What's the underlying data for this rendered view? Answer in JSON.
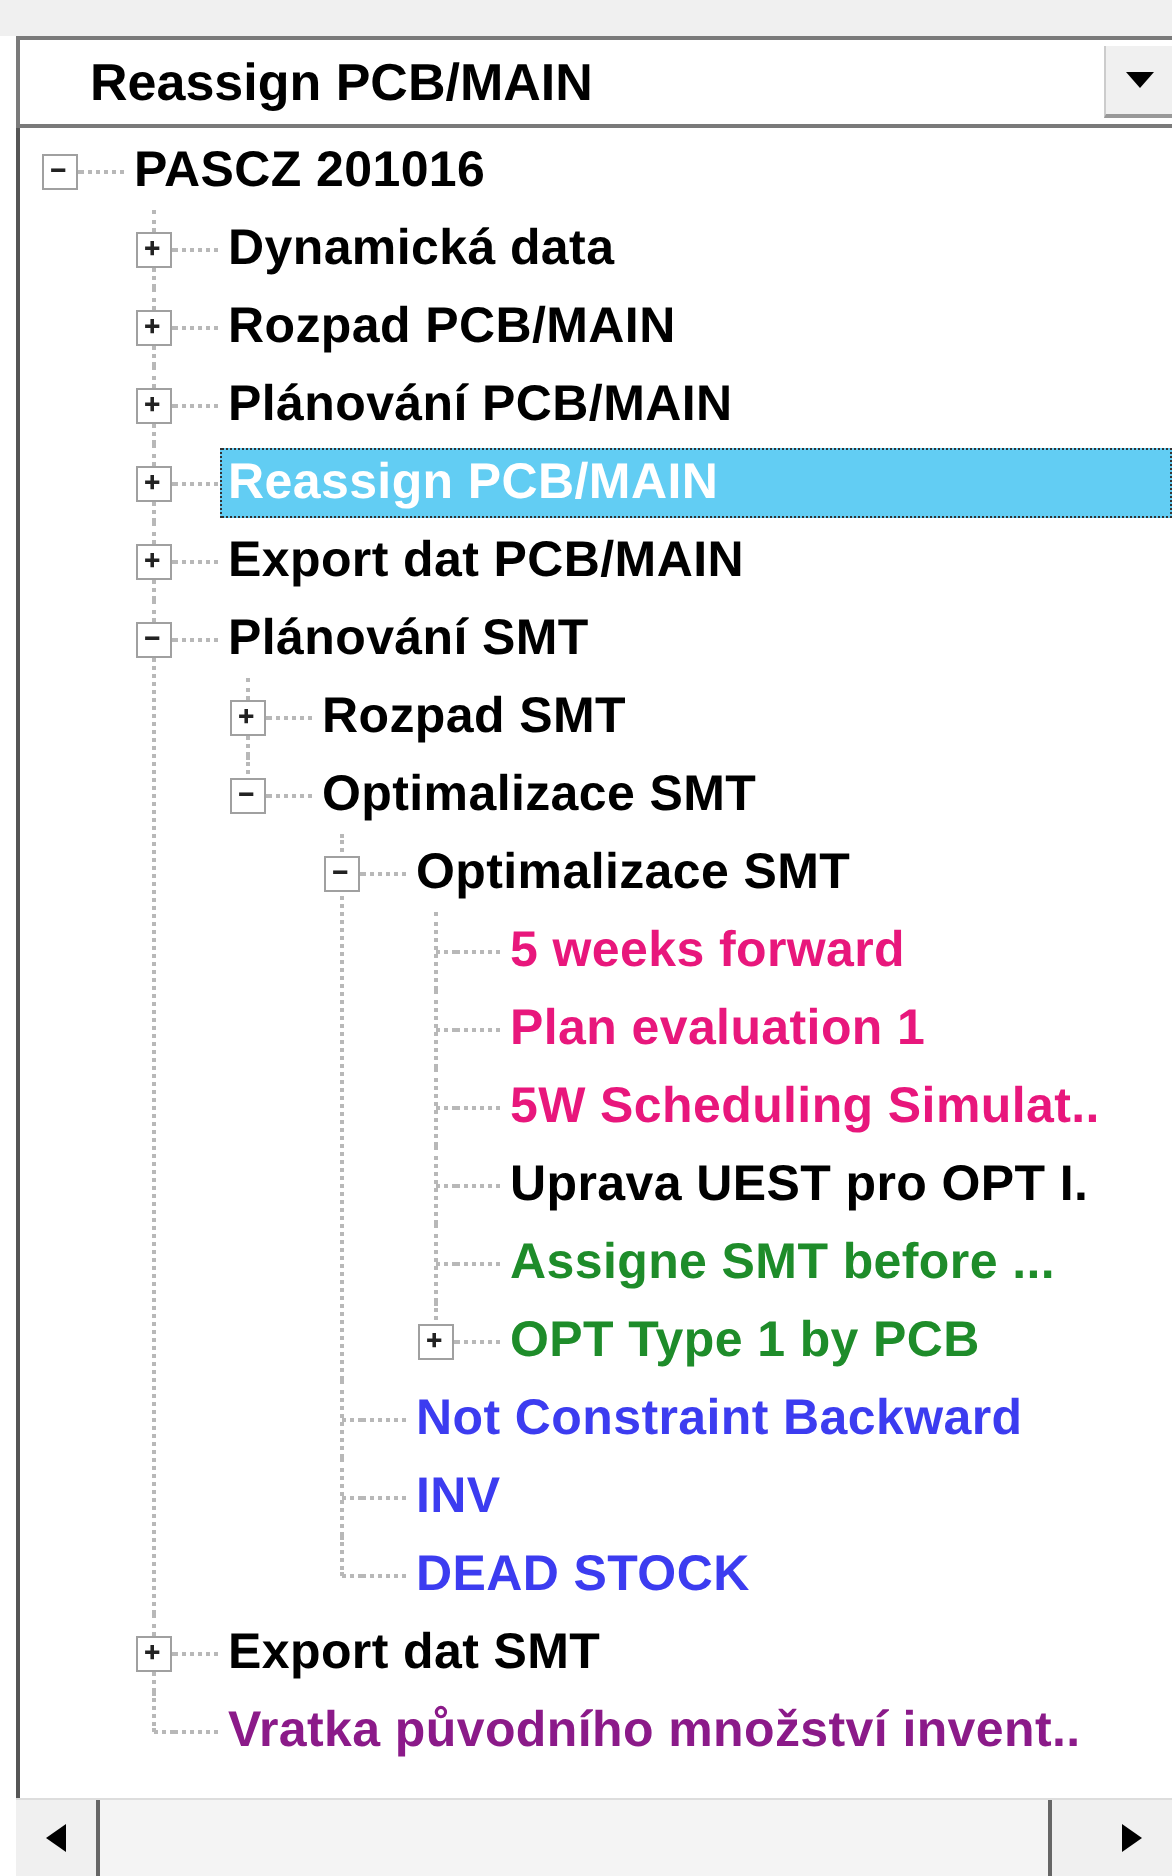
{
  "combo": {
    "value": "Reassign PCB/MAIN"
  },
  "tree": [
    {
      "label": "PASCZ 201016",
      "expanded": true,
      "selected": false,
      "color": "#000000",
      "children": [
        {
          "label": "Dynamická data",
          "expanded": false,
          "selected": false,
          "color": "#000000"
        },
        {
          "label": "Rozpad PCB/MAIN",
          "expanded": false,
          "selected": false,
          "color": "#000000"
        },
        {
          "label": "Plánování PCB/MAIN",
          "expanded": false,
          "selected": false,
          "color": "#000000"
        },
        {
          "label": "Reassign PCB/MAIN",
          "expanded": false,
          "selected": true
        },
        {
          "label": "Export dat PCB/MAIN",
          "expanded": false,
          "selected": false,
          "color": "#000000"
        },
        {
          "label": "Plánování SMT",
          "expanded": true,
          "selected": false,
          "color": "#000000",
          "children": [
            {
              "label": "Rozpad SMT",
              "expanded": false,
              "selected": false,
              "color": "#000000"
            },
            {
              "label": "Optimalizace SMT",
              "expanded": true,
              "selected": false,
              "color": "#000000",
              "children": [
                {
                  "label": "Optimalizace SMT",
                  "expanded": true,
                  "selected": false,
                  "color": "#000000",
                  "children": [
                    {
                      "label": "5 weeks forward",
                      "selected": false,
                      "color": "#e8177c"
                    },
                    {
                      "label": "Plan evaluation 1",
                      "selected": false,
                      "color": "#e8177c"
                    },
                    {
                      "label": "5W Scheduling Simulat..",
                      "selected": false,
                      "color": "#e8177c"
                    },
                    {
                      "label": "Uprava UEST pro OPT I.",
                      "selected": false,
                      "color": "#000000"
                    },
                    {
                      "label": "Assigne SMT before ...",
                      "selected": false,
                      "color": "#1e8c2a"
                    },
                    {
                      "label": "OPT Type 1 by PCB",
                      "expanded": false,
                      "selected": false,
                      "color": "#1e8c2a"
                    }
                  ]
                },
                {
                  "label": "Not Constraint Backward",
                  "selected": false,
                  "color": "#3c3cf0"
                },
                {
                  "label": "INV",
                  "selected": false,
                  "color": "#3c3cf0"
                },
                {
                  "label": "DEAD STOCK",
                  "selected": false,
                  "color": "#3c3cf0"
                }
              ]
            }
          ]
        },
        {
          "label": "Export dat SMT",
          "expanded": false,
          "selected": false,
          "color": "#000000"
        },
        {
          "label": "Vratka původního množství invent..",
          "selected": false,
          "color": "#8b1a89"
        }
      ]
    }
  ]
}
